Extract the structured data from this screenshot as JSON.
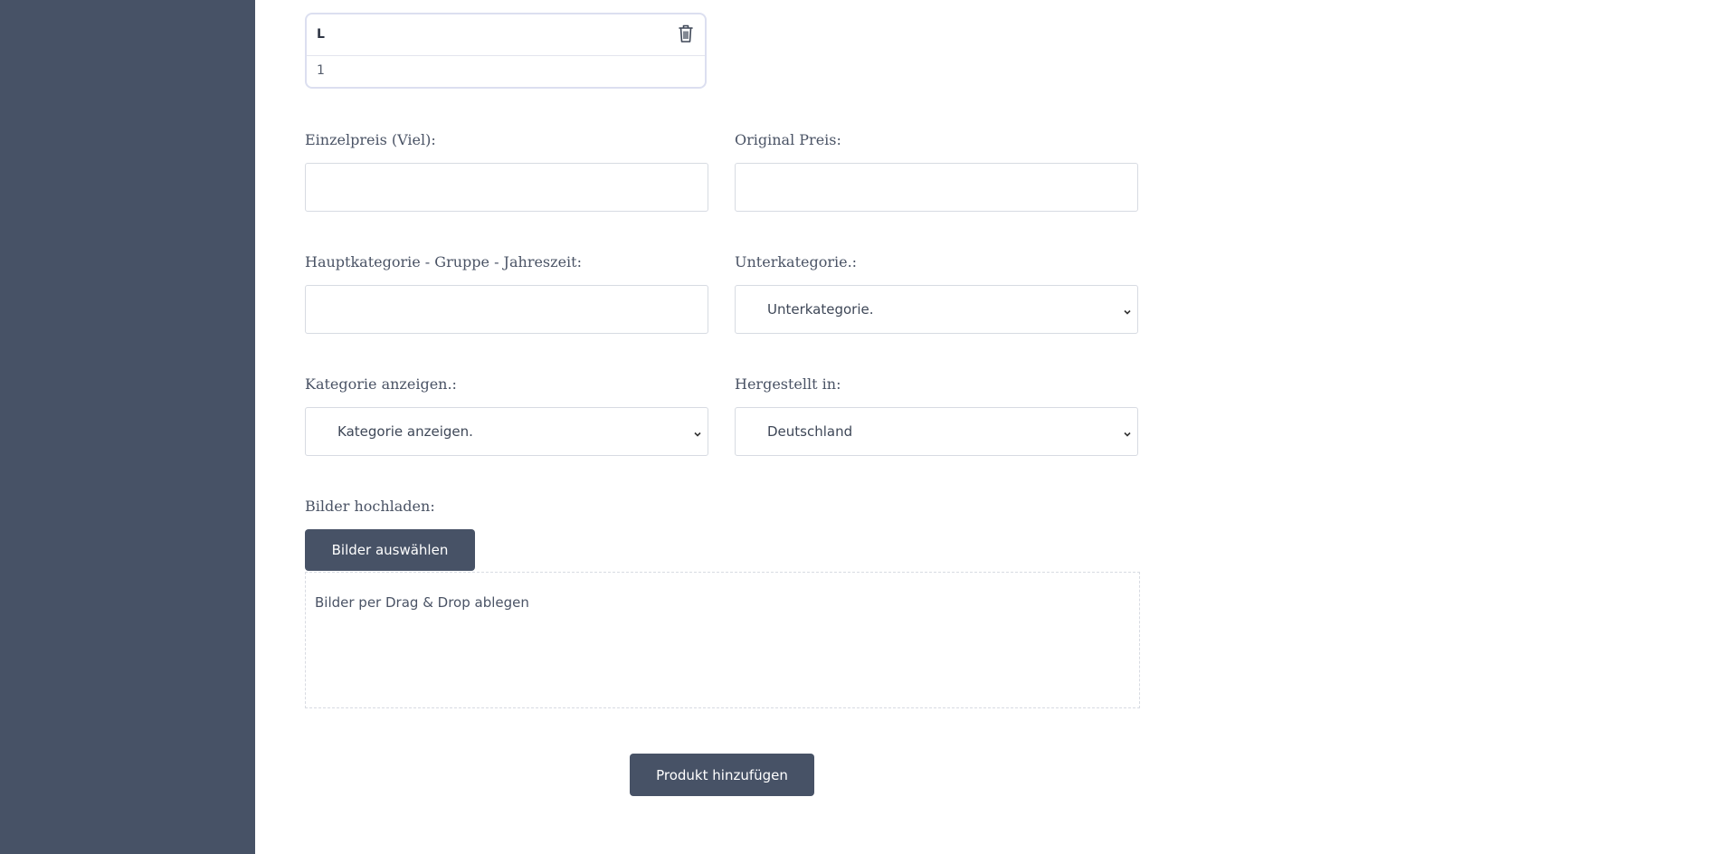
{
  "size_entry": {
    "size": "L",
    "quantity": "1",
    "delete_icon": "trash-icon"
  },
  "form": {
    "unit_price_label": "Einzelpreis (Viel):",
    "unit_price_value": "",
    "original_price_label": "Original Preis:",
    "original_price_value": "",
    "main_category_label": "Hauptkategorie - Gruppe - Jahreszeit:",
    "main_category_value": "",
    "subcategory_label": "Unterkategorie.:",
    "subcategory_selected": "Unterkategorie.",
    "show_category_label": "Kategorie anzeigen.:",
    "show_category_selected": "Kategorie anzeigen.",
    "made_in_label": "Hergestellt in:",
    "made_in_selected": "Deutschland",
    "upload_label": "Bilder hochladen:",
    "select_images_button": "Bilder auswählen",
    "dropzone_text": "Bilder per Drag & Drop ablegen",
    "submit_button": "Produkt hinzufügen"
  },
  "colors": {
    "sidebar": "#475266",
    "button": "#475266"
  }
}
